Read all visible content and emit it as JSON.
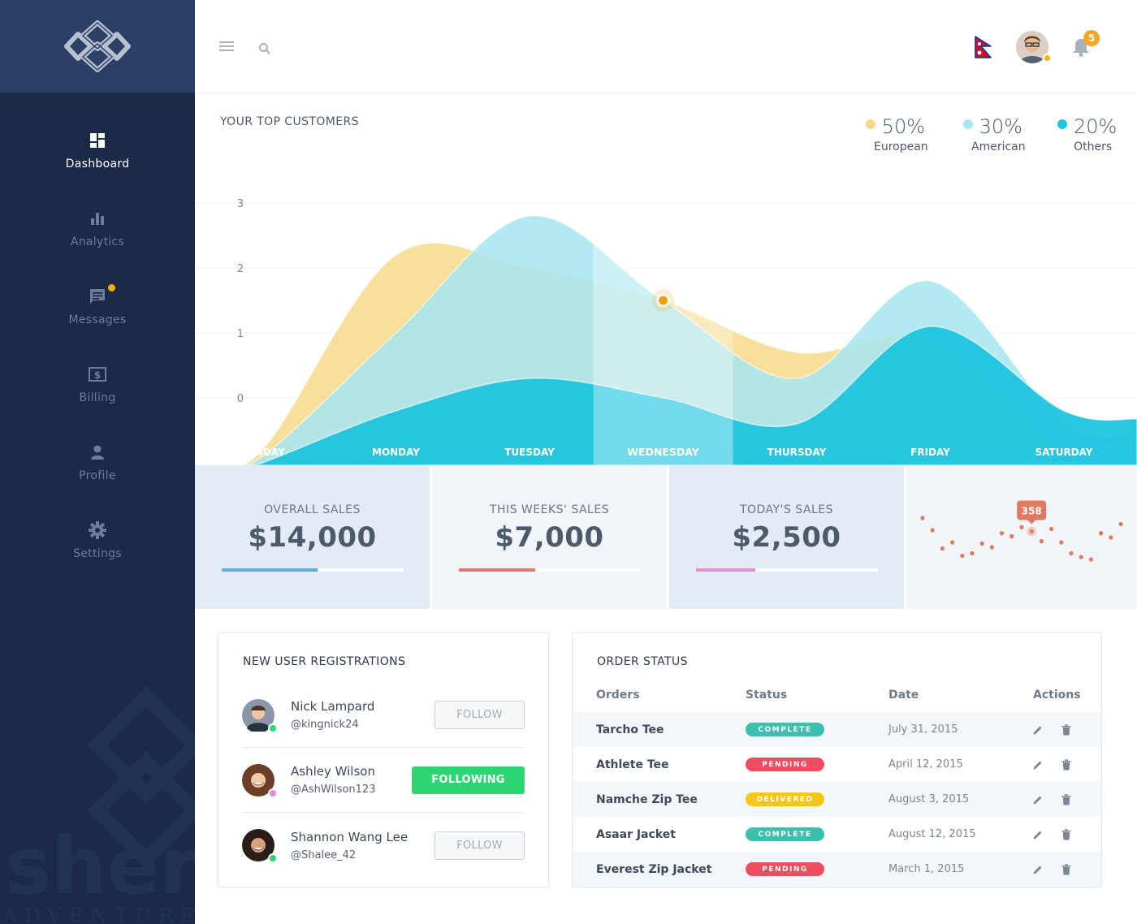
{
  "sidebar": {
    "watermark_text": "sher",
    "watermark_sub": "ADVENTURE",
    "items": [
      {
        "label": "Dashboard",
        "icon": "dashboard-icon",
        "active": true
      },
      {
        "label": "Analytics",
        "icon": "analytics-icon",
        "active": false
      },
      {
        "label": "Messages",
        "icon": "messages-icon",
        "active": false
      },
      {
        "label": "Billing",
        "icon": "billing-icon",
        "active": false
      },
      {
        "label": "Profile",
        "icon": "profile-icon",
        "active": false
      },
      {
        "label": "Settings",
        "icon": "settings-icon",
        "active": false
      }
    ]
  },
  "topbar": {
    "notifications_count": "5"
  },
  "chart": {
    "title": "YOUR TOP CUSTOMERS",
    "legend": [
      {
        "value": "50%",
        "name": "European",
        "color": "#f8d98b"
      },
      {
        "value": "30%",
        "name": "American",
        "color": "#a6e6f0"
      },
      {
        "value": "20%",
        "name": "Others",
        "color": "#20c4de"
      }
    ]
  },
  "chart_data": {
    "type": "area",
    "title": "YOUR TOP CUSTOMERS",
    "categories": [
      "SUNDAY",
      "MONDAY",
      "TUESDAY",
      "WEDNESDAY",
      "THURSDAY",
      "FRIDAY",
      "SATURDAY"
    ],
    "highlighted_category": "WEDNESDAY",
    "y_ticks": [
      "0",
      "1",
      "2",
      "3"
    ],
    "ylim": [
      0,
      3
    ],
    "grid": true,
    "legend_position": "top-right",
    "series": [
      {
        "name": "European",
        "share": "50%",
        "color": "#f8d98b",
        "values": [
          -0.8,
          2.2,
          2.0,
          1.5,
          0.7,
          0.9,
          -0.8
        ]
      },
      {
        "name": "American",
        "share": "30%",
        "color": "#a6e6f0",
        "values": [
          -0.9,
          1.0,
          2.8,
          1.5,
          0.3,
          1.8,
          -0.4
        ]
      },
      {
        "name": "Others",
        "share": "20%",
        "color": "#20c4de",
        "values": [
          -1.0,
          -0.2,
          0.3,
          0.0,
          -0.4,
          1.1,
          -0.2
        ]
      }
    ],
    "highlight_point": {
      "series": "European",
      "category": "WEDNESDAY",
      "value": 1.5
    }
  },
  "stats": [
    {
      "label": "OVERALL SALES",
      "value": "$14,000",
      "progress": 0.53,
      "color": "#5aaee0"
    },
    {
      "label": "THIS WEEKS' SALES",
      "value": "$7,000",
      "progress": 0.42,
      "color": "#e57373"
    },
    {
      "label": "TODAY'S SALES",
      "value": "$2,500",
      "progress": 0.33,
      "color": "#e98ad8"
    }
  ],
  "sparkline": {
    "tooltip": "358",
    "color": "#e07a5f",
    "values": [
      80,
      60,
      30,
      40,
      18,
      22,
      38,
      32,
      55,
      50,
      65,
      58,
      42,
      62,
      40,
      22,
      16,
      12,
      55,
      48,
      70
    ]
  },
  "registrations": {
    "title": "NEW USER REGISTRATIONS",
    "users": [
      {
        "name": "Nick  Lampard",
        "handle": "@kingnick24",
        "action": "FOLLOW",
        "following": false,
        "status_color": "#2ed573"
      },
      {
        "name": "Ashley Wilson",
        "handle": "@AshWilson123",
        "action": "FOLLOWING",
        "following": true,
        "status_color": "#e98ad8"
      },
      {
        "name": "Shannon Wang Lee",
        "handle": "@Shalee_42",
        "action": "FOLLOW",
        "following": false,
        "status_color": "#2ed573"
      }
    ]
  },
  "orders": {
    "title": "ORDER STATUS",
    "headers": [
      "Orders",
      "Status",
      "Date",
      "Actions"
    ],
    "rows": [
      {
        "name": "Tarcho Tee",
        "status": "COMPLETE",
        "color": "#3cbfae",
        "date": "July 31, 2015"
      },
      {
        "name": "Athlete Tee",
        "status": "PENDING",
        "color": "#ee4d5f",
        "date": "April 12, 2015"
      },
      {
        "name": "Namche Zip Tee",
        "status": "DELIVERED",
        "color": "#f5c518",
        "date": "August 3, 2015"
      },
      {
        "name": "Asaar Jacket",
        "status": "COMPLETE",
        "color": "#3cbfae",
        "date": "August 12, 2015"
      },
      {
        "name": "Everest Zip Jacket",
        "status": "PENDING",
        "color": "#ee4d5f",
        "date": "March 1, 2015"
      }
    ]
  }
}
